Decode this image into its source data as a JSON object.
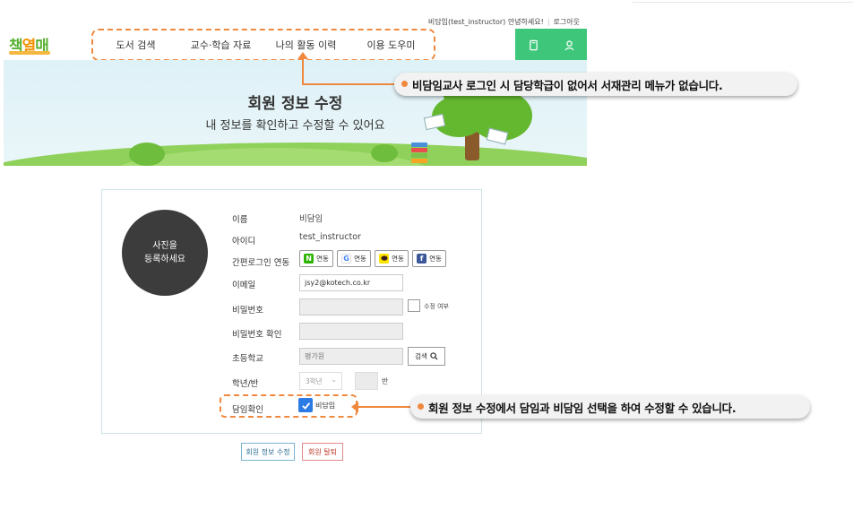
{
  "header": {
    "user_greeting": "비담임(test_instructor) 안녕하세요!",
    "logout": "로그아웃",
    "logo_part1": "책",
    "logo_part2": "열",
    "logo_part3": "매",
    "nav": [
      "도서 검색",
      "교수·학습 자료",
      "나의 활동 이력",
      "이용 도우미"
    ],
    "icon_book": "book-icon",
    "icon_user": "user-icon"
  },
  "banner": {
    "title": "회원 정보 수정",
    "subtitle": "내 정보를 확인하고 수정할 수 있어요"
  },
  "callouts": {
    "menu_note": "비담임교사 로그인 시 담당학급이 없어서 서재관리 메뉴가 없습니다.",
    "homeroom_note": "회원 정보 수정에서 담임과 비담임 선택을 하여 수정할 수 있습니다."
  },
  "form": {
    "photo_line1": "사진을",
    "photo_line2": "등록하세요",
    "name_label": "이름",
    "name_value": "비담임",
    "id_label": "아이디",
    "id_value": "test_instructor",
    "sns_label": "간편로그인 연동",
    "sns_buttons": [
      {
        "brand": "N",
        "label": "연동",
        "color": "#2db400"
      },
      {
        "brand": "G",
        "label": "연동",
        "color": "#4285f4"
      },
      {
        "brand": "kakao",
        "label": "연동",
        "color": "#fee500"
      },
      {
        "brand": "f",
        "label": "연동",
        "color": "#3b5998"
      }
    ],
    "email_label": "이메일",
    "email_value": "jsy2@kotech.co.kr",
    "password_label": "비밀번호",
    "password_edit_label": "수정 여부",
    "password_confirm_label": "비밀번호 확인",
    "school_label": "초등학교",
    "school_value": "평가원",
    "search_label": "검색",
    "grade_label": "학년/반",
    "grade_value": "3학년",
    "ban_unit": "반",
    "homeroom_label": "담임확인",
    "homeroom_option": "비담임",
    "homeroom_checked": true
  },
  "actions": {
    "save": "회원 정보 수정",
    "withdraw": "회원 탈퇴"
  }
}
